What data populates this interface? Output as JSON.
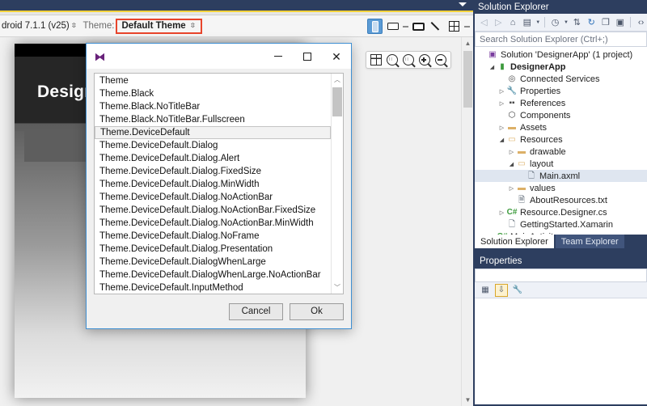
{
  "designer_toolbar": {
    "device_label": "droid 7.1.1 (v25)",
    "theme_label": "Theme:",
    "theme_value": "Default Theme",
    "spinner_glyph": "⇳",
    "highlight_color": "#e8452c",
    "buttons": [
      {
        "name": "portrait-view-button",
        "icon": "phone-portrait-icon",
        "active": true
      },
      {
        "name": "landscape-view-button",
        "icon": "phone-landscape-icon",
        "active": false
      },
      {
        "name": "tablet-view-button",
        "icon": "tablet-icon",
        "active": false
      },
      {
        "name": "theme-brush-button",
        "icon": "paintbrush-icon",
        "active": false
      },
      {
        "name": "grid-layout-button",
        "icon": "grid-icon",
        "active": false
      }
    ]
  },
  "zoom_toolbar": {
    "buttons": [
      {
        "name": "fit-to-window-button",
        "icon": "fit-window-icon"
      },
      {
        "name": "zoom-to-fit-button",
        "icon": "zoom-fit-icon"
      },
      {
        "name": "zoom-actual-size-button",
        "icon": "zoom-actual-icon"
      },
      {
        "name": "zoom-in-button",
        "icon": "zoom-in-icon"
      },
      {
        "name": "zoom-out-button",
        "icon": "zoom-out-icon"
      }
    ]
  },
  "canvas": {
    "app_title": "Designe"
  },
  "dialog": {
    "title": "",
    "logo_glyph": "⧓",
    "window_buttons": {
      "minimize": "minimize-icon",
      "maximize": "maximize-icon",
      "close": "✕"
    },
    "selected_item": "Theme.DeviceDefault",
    "items": [
      "Theme",
      "Theme.Black",
      "Theme.Black.NoTitleBar",
      "Theme.Black.NoTitleBar.Fullscreen",
      "Theme.DeviceDefault",
      "Theme.DeviceDefault.Dialog",
      "Theme.DeviceDefault.Dialog.Alert",
      "Theme.DeviceDefault.Dialog.FixedSize",
      "Theme.DeviceDefault.Dialog.MinWidth",
      "Theme.DeviceDefault.Dialog.NoActionBar",
      "Theme.DeviceDefault.Dialog.NoActionBar.FixedSize",
      "Theme.DeviceDefault.Dialog.NoActionBar.MinWidth",
      "Theme.DeviceDefault.Dialog.NoFrame",
      "Theme.DeviceDefault.Dialog.Presentation",
      "Theme.DeviceDefault.DialogWhenLarge",
      "Theme.DeviceDefault.DialogWhenLarge.NoActionBar",
      "Theme.DeviceDefault.InputMethod"
    ],
    "cancel_label": "Cancel",
    "ok_label": "Ok"
  },
  "solution_explorer": {
    "panel_title": "Solution Explorer",
    "search_placeholder": "Search Solution Explorer (Ctrl+;)",
    "toolbar_icons": [
      "back-icon",
      "forward-icon",
      "home-icon",
      "pending-changes-icon",
      "chevron-down-icon",
      "show-all-files-icon",
      "chevron-down-icon",
      "sync-with-active-document-icon",
      "refresh-icon",
      "collapse-all-icon",
      "properties-window-icon",
      "code-view-icon"
    ],
    "tree": [
      {
        "indent": 0,
        "twist": "",
        "icon": "solution-icon",
        "label": "Solution 'DesignerApp' (1 project)",
        "bold": false,
        "selected": false
      },
      {
        "indent": 1,
        "twist": "▲",
        "icon": "android-project-icon",
        "label": "DesignerApp",
        "bold": true,
        "selected": false
      },
      {
        "indent": 2,
        "twist": "",
        "icon": "connected-services-icon",
        "label": "Connected Services",
        "bold": false,
        "selected": false
      },
      {
        "indent": 2,
        "twist": "▶",
        "icon": "properties-icon",
        "label": "Properties",
        "bold": false,
        "selected": false
      },
      {
        "indent": 2,
        "twist": "▶",
        "icon": "references-icon",
        "label": "References",
        "bold": false,
        "selected": false
      },
      {
        "indent": 2,
        "twist": "",
        "icon": "components-icon",
        "label": "Components",
        "bold": false,
        "selected": false
      },
      {
        "indent": 2,
        "twist": "▶",
        "icon": "folder-icon",
        "label": "Assets",
        "bold": false,
        "selected": false
      },
      {
        "indent": 2,
        "twist": "▲",
        "icon": "folder-open-icon",
        "label": "Resources",
        "bold": false,
        "selected": false
      },
      {
        "indent": 3,
        "twist": "▶",
        "icon": "folder-icon",
        "label": "drawable",
        "bold": false,
        "selected": false
      },
      {
        "indent": 3,
        "twist": "▲",
        "icon": "folder-open-icon",
        "label": "layout",
        "bold": false,
        "selected": false
      },
      {
        "indent": 4,
        "twist": "",
        "icon": "axml-file-icon",
        "label": "Main.axml",
        "bold": false,
        "selected": true
      },
      {
        "indent": 3,
        "twist": "▶",
        "icon": "folder-icon",
        "label": "values",
        "bold": false,
        "selected": false
      },
      {
        "indent": 3,
        "twist": "",
        "icon": "text-file-icon",
        "label": "AboutResources.txt",
        "bold": false,
        "selected": false
      },
      {
        "indent": 2,
        "twist": "▶",
        "icon": "csharp-file-icon",
        "label": "Resource.Designer.cs",
        "bold": false,
        "selected": false
      },
      {
        "indent": 2,
        "twist": "",
        "icon": "file-icon",
        "label": "GettingStarted.Xamarin",
        "bold": false,
        "selected": false
      },
      {
        "indent": 1,
        "twist": "▶",
        "icon": "csharp-file-icon",
        "label": "MainActivity.cs",
        "bold": false,
        "selected": false
      }
    ],
    "tabs": [
      {
        "label": "Solution Explorer",
        "active": true
      },
      {
        "label": "Team Explorer",
        "active": false
      }
    ]
  },
  "properties_panel": {
    "panel_title": "Properties",
    "toolbar_icons": [
      "categorized-view-icon",
      "alphabetical-sort-icon",
      "property-pages-icon"
    ]
  },
  "theme_colors": {
    "vs_navy": "#2d3e5f",
    "accent_blue": "#3f8fd2",
    "highlight_red": "#e8452c",
    "selection_blue": "#5b9bd5"
  }
}
